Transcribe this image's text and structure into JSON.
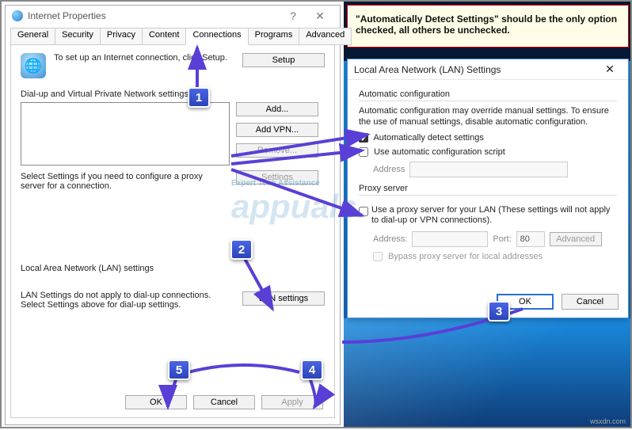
{
  "note": "\"Automatically Detect Settings\" should be the only option checked, all others be unchecked.",
  "ip": {
    "title": "Internet Properties",
    "tabs": [
      "General",
      "Security",
      "Privacy",
      "Content",
      "Connections",
      "Programs",
      "Advanced"
    ],
    "active_tab": 4,
    "setup_text": "To set up an Internet connection, click Setup.",
    "btn_setup": "Setup",
    "dialup_label": "Dial-up and Virtual Private Network settings",
    "btn_add": "Add...",
    "btn_addvpn": "Add VPN...",
    "btn_remove": "Remove...",
    "btn_settings": "Settings",
    "select_text": "Select Settings if you need to configure a proxy server for a connection.",
    "lan_label": "Local Area Network (LAN) settings",
    "lan_desc": "LAN Settings do not apply to dial-up connections. Select Settings above for dial-up settings.",
    "btn_lan": "LAN settings",
    "btn_ok": "OK",
    "btn_cancel": "Cancel",
    "btn_apply": "Apply"
  },
  "lan": {
    "title": "Local Area Network (LAN) Settings",
    "auto_header": "Automatic configuration",
    "auto_desc": "Automatic configuration may override manual settings.  To ensure the use of manual settings, disable automatic configuration.",
    "chk_autodetect": "Automatically detect settings",
    "chk_autoscript": "Use automatic configuration script",
    "addr_label": "Address",
    "proxy_header": "Proxy server",
    "chk_proxy": "Use a proxy server for your LAN (These settings will not apply to dial-up or VPN connections).",
    "addr2_label": "Address:",
    "port_label": "Port:",
    "port_value": "80",
    "btn_advanced": "Advanced",
    "chk_bypass": "Bypass proxy server for local addresses",
    "btn_ok": "OK",
    "btn_cancel": "Cancel"
  },
  "watermark": {
    "brand": "appuals.",
    "tagline": "Expert Tech Assistance"
  },
  "callouts": [
    "1",
    "2",
    "3",
    "4",
    "5"
  ],
  "credit": "wsxdn.com"
}
